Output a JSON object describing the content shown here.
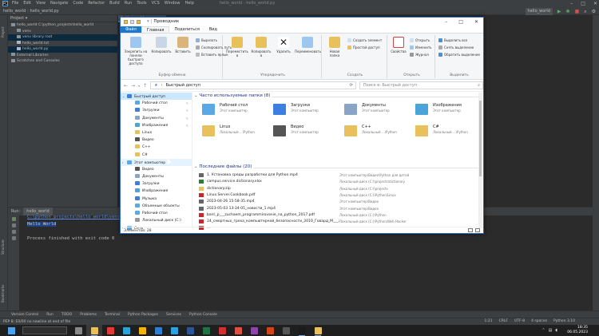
{
  "ide": {
    "menu": [
      "File",
      "Edit",
      "View",
      "Navigate",
      "Code",
      "Refactor",
      "Build",
      "Run",
      "Tools",
      "VCS",
      "Window",
      "Help"
    ],
    "window_title": "hello_world - hello_world.py",
    "nav_path": "hello_world",
    "nav_file": "hello_world.py",
    "run_config": "hello_world",
    "project_label": "Project",
    "project_tree": [
      {
        "label": "hello_world  C:\\python_projects\\hello_world",
        "sel": false,
        "depth": 0
      },
      {
        "label": "venv",
        "sel": false,
        "depth": 1
      },
      {
        "label": "venv  library root",
        "sel": true,
        "depth": 1
      },
      {
        "label": "hello_world.txt",
        "sel": false,
        "depth": 1
      },
      {
        "label": "hello_world.py",
        "sel": true,
        "depth": 1
      },
      {
        "label": "External Libraries",
        "sel": false,
        "depth": 0
      },
      {
        "label": "Scratches and Consoles",
        "sel": false,
        "depth": 0
      }
    ],
    "editor_tab": "hello_world",
    "run_tab_label": "Run:",
    "run_tab": "hello_world",
    "run_path": "C:\\python_projects\\hello_world\\venv\\Scripts\\python.exe",
    "run_output": "Hello World",
    "run_exit": "Process finished with exit code 0",
    "bottom_tools": [
      "Version Control",
      "Run",
      "TODO",
      "Problems",
      "Terminal",
      "Python Packages",
      "Services",
      "Python Console"
    ],
    "status_left": "PEP 8: E0/00 no newline at end of file",
    "status_right": [
      "1:21",
      "CRLF",
      "UTF-8",
      "4 spaces",
      "Python 3.10"
    ],
    "strip_left": [
      "Project",
      "Structure",
      "Bookmarks"
    ]
  },
  "explorer": {
    "title": "Проводник",
    "tabs": [
      "Файл",
      "Главная",
      "Поделиться",
      "Вид"
    ],
    "ribbon": {
      "pin": "Закрепить на панели быстрого доступа",
      "copy": "Копировать",
      "paste": "Вставить",
      "cut": "Вырезать",
      "copy_path": "Скопировать путь",
      "paste_shortcut": "Вставить ярлык",
      "clipboard_group": "Буфер обмена",
      "move_to": "Переместить в",
      "copy_to": "Копировать в",
      "delete": "Удалить",
      "rename": "Переименовать",
      "organize_group": "Упорядочить",
      "new_folder": "Новая папка",
      "new_item": "Создать элемент",
      "easy_access": "Простой доступ",
      "create_group": "Создать",
      "properties": "Свойства",
      "open": "Открыть",
      "edit": "Изменить",
      "history": "Журнал",
      "open_group": "Открыть",
      "select_all": "Выделить все",
      "select_none": "Снять выделение",
      "invert": "Обратить выделение",
      "select_group": "Выделить"
    },
    "address": "Быстрый доступ",
    "search_placeholder": "Поиск в: Быстрый доступ",
    "nav": [
      {
        "label": "Быстрый доступ",
        "sel": true,
        "depth": 0,
        "pin": false,
        "color": "#3d7ee0"
      },
      {
        "label": "Рабочий стол",
        "depth": 1,
        "pin": true,
        "color": "#5aa9e6"
      },
      {
        "label": "Загрузки",
        "depth": 1,
        "pin": true,
        "color": "#3d7ee0"
      },
      {
        "label": "Документы",
        "depth": 1,
        "pin": true,
        "color": "#8aa4c8"
      },
      {
        "label": "Изображения",
        "depth": 1,
        "pin": true,
        "color": "#4ca3d8"
      },
      {
        "label": "Linux",
        "depth": 1,
        "pin": false,
        "color": "#e8c15c"
      },
      {
        "label": "Видео",
        "depth": 1,
        "pin": false,
        "color": "#555"
      },
      {
        "label": "С++",
        "depth": 1,
        "pin": false,
        "color": "#e8c15c"
      },
      {
        "label": "С#",
        "depth": 1,
        "pin": false,
        "color": "#e8c15c"
      },
      {
        "label": "Этот компьютер",
        "hov": true,
        "depth": 0,
        "pin": false,
        "color": "#5aa9e6"
      },
      {
        "label": "Видео",
        "depth": 1,
        "pin": false,
        "color": "#555"
      },
      {
        "label": "Документы",
        "depth": 1,
        "pin": false,
        "color": "#8aa4c8"
      },
      {
        "label": "Загрузки",
        "depth": 1,
        "pin": false,
        "color": "#3d7ee0"
      },
      {
        "label": "Изображения",
        "depth": 1,
        "pin": false,
        "color": "#4ca3d8"
      },
      {
        "label": "Музыка",
        "depth": 1,
        "pin": false,
        "color": "#3d7ee0"
      },
      {
        "label": "Объемные объекты",
        "depth": 1,
        "pin": false,
        "color": "#5aa9e6"
      },
      {
        "label": "Рабочий стол",
        "depth": 1,
        "pin": false,
        "color": "#5aa9e6"
      },
      {
        "label": "Локальный диск (C:)",
        "depth": 1,
        "pin": false,
        "color": "#999"
      },
      {
        "label": "Сеть",
        "depth": 0,
        "pin": false,
        "color": "#5aa9e6"
      }
    ],
    "frequent_title": "Часто используемые папки (8)",
    "frequent": [
      {
        "name": "Рабочий стол",
        "sub": "Этот компьютер",
        "color": "#5aa9e6"
      },
      {
        "name": "Загрузки",
        "sub": "Этот компьютер",
        "color": "#3d7ee0"
      },
      {
        "name": "Документы",
        "sub": "Этот компьютер",
        "color": "#8aa4c8"
      },
      {
        "name": "Изображения",
        "sub": "Этот компьютер",
        "color": "#4ca3d8"
      },
      {
        "name": "Linux",
        "sub": "Локальный ...\\Python",
        "color": "#e8c15c"
      },
      {
        "name": "Видео",
        "sub": "Этот компьютер",
        "color": "#555"
      },
      {
        "name": "С++",
        "sub": "Локальный ...\\Python",
        "color": "#e8c15c"
      },
      {
        "name": "С#",
        "sub": "Локальный ...\\Python",
        "color": "#e8c15c"
      }
    ],
    "recent_title": "Последние файлы (20)",
    "recent": [
      {
        "name": "1. Установка среды разработки для Python.mp4",
        "loc": "Этот компьютер\\Видео\\Python для детей",
        "color": "#666"
      },
      {
        "name": "campus.service.dictionary.xlsx",
        "loc": "Локальный диск (C:)\\projects\\dictionary",
        "color": "#2e7d32"
      },
      {
        "name": "dictionary.zip",
        "loc": "Локальный диск (C:)\\projects",
        "color": "#e8c15c"
      },
      {
        "name": "Linux.Server.Cookbook.pdf",
        "loc": "Локальный диск (C:)\\Python\\Linux",
        "color": "#c62828"
      },
      {
        "name": "2023-04-26 15-58-35.mp4",
        "loc": "Этот компьютер\\Видео",
        "color": "#666"
      },
      {
        "name": "2023-05-03 13-34-05_новости_1.mp4",
        "loc": "Этот компьютер\\Видео",
        "color": "#666"
      },
      {
        "name": "barri_p___zuchaem_programmirovanie_na_python_2017.pdf",
        "loc": "Локальный диск (C:)\\Python",
        "color": "#c62828"
      },
      {
        "name": "24_смертных_греха_компьютерной_безопасности_2010_Говард_М___Леб...",
        "loc": "Локальный диск (C:)\\Python\\Web Hacker",
        "color": "#c62828"
      },
      {
        "name": "...",
        "loc": "",
        "color": "#c62828"
      }
    ],
    "status": "Элементов: 28"
  },
  "taskbar": {
    "search": "",
    "apps": [
      {
        "name": "windows-start-icon",
        "color": "#4aa3f0"
      },
      {
        "name": "task-view-icon",
        "color": "#888"
      },
      {
        "name": "explorer-icon",
        "color": "#e8c15c",
        "open": true,
        "active": true
      },
      {
        "name": "yandex-browser-icon",
        "color": "#e53935"
      },
      {
        "name": "edge-icon",
        "color": "#2aa3d8"
      },
      {
        "name": "chrome-icon",
        "color": "#f4b400"
      },
      {
        "name": "vscode-icon",
        "color": "#2d7fd3"
      },
      {
        "name": "telegram-icon",
        "color": "#2aa3e0"
      },
      {
        "name": "word-icon",
        "color": "#2b579a"
      },
      {
        "name": "excel-icon",
        "color": "#217346"
      },
      {
        "name": "opera-icon",
        "color": "#d32f2f"
      },
      {
        "name": "davinci-icon",
        "color": "#e05040"
      },
      {
        "name": "visual-studio-icon",
        "color": "#8e44ad"
      },
      {
        "name": "app-icon-red",
        "color": "#d84315"
      },
      {
        "name": "obs-icon",
        "color": "#555"
      },
      {
        "name": "pycharm-icon",
        "color": "#1b1b1b",
        "open": true
      },
      {
        "name": "folder-icon",
        "color": "#e8c15c",
        "open": true
      }
    ],
    "time": "18:35",
    "date": "06.05.2023"
  }
}
